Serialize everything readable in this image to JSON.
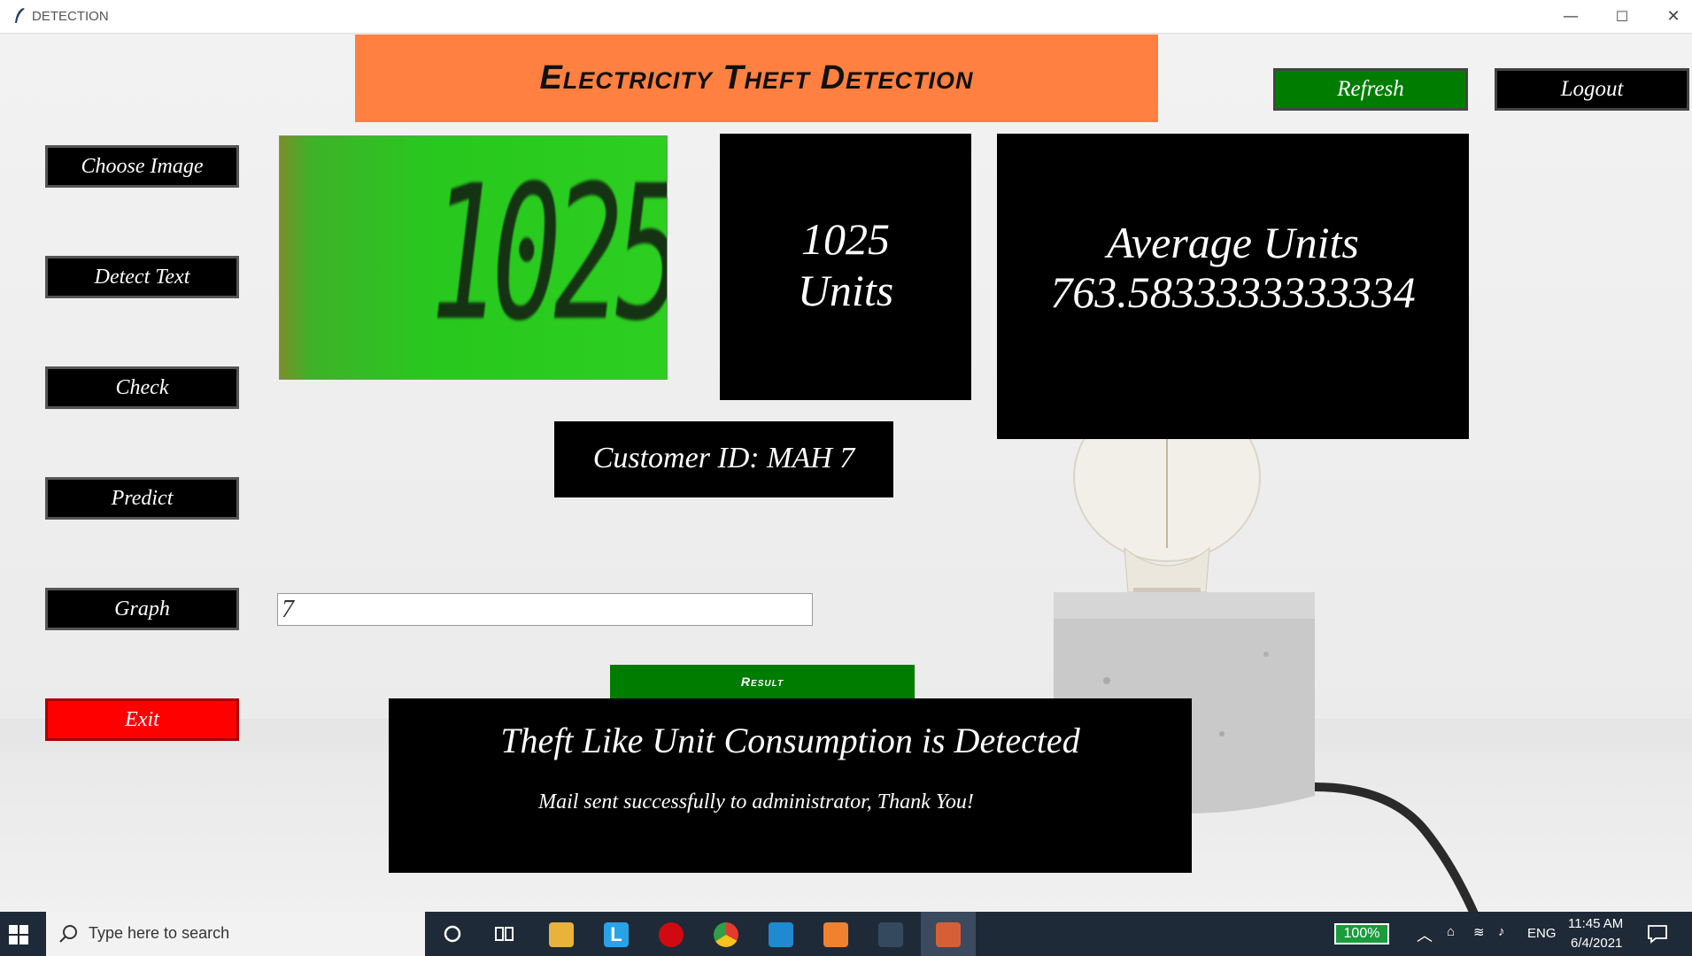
{
  "window": {
    "title": "DETECTION",
    "minimize": "—",
    "maximize": "☐",
    "close": "✕"
  },
  "header": {
    "title": "Electricity Theft Detection"
  },
  "top_buttons": {
    "refresh": "Refresh",
    "logout": "Logout"
  },
  "sidebar": {
    "choose_image": "Choose Image",
    "detect_text": "Detect Text",
    "check": "Check",
    "predict": "Predict",
    "graph": "Graph",
    "exit": "Exit"
  },
  "meter_reading": {
    "digits": "1025"
  },
  "units_box": {
    "value": "1025",
    "label": "Units"
  },
  "average_box": {
    "label": "Average Units",
    "value": "763.5833333333334"
  },
  "customer": {
    "label": "Customer ID: MAH 7"
  },
  "input": {
    "value": "7"
  },
  "result_button": {
    "label": "Result"
  },
  "result_box": {
    "headline": "Theft Like Unit Consumption is Detected",
    "message": "Mail sent successfully to administrator, Thank You!"
  },
  "taskbar": {
    "search_placeholder": "Type here to search",
    "battery": "100%",
    "language": "ENG",
    "time": "11:45 AM",
    "date": "6/4/2021"
  },
  "colors": {
    "header_bg": "#ff8040",
    "refresh_bg": "#007d00",
    "result_bg": "#007d00",
    "exit_bg": "#ff0000",
    "box_bg": "#000000"
  }
}
